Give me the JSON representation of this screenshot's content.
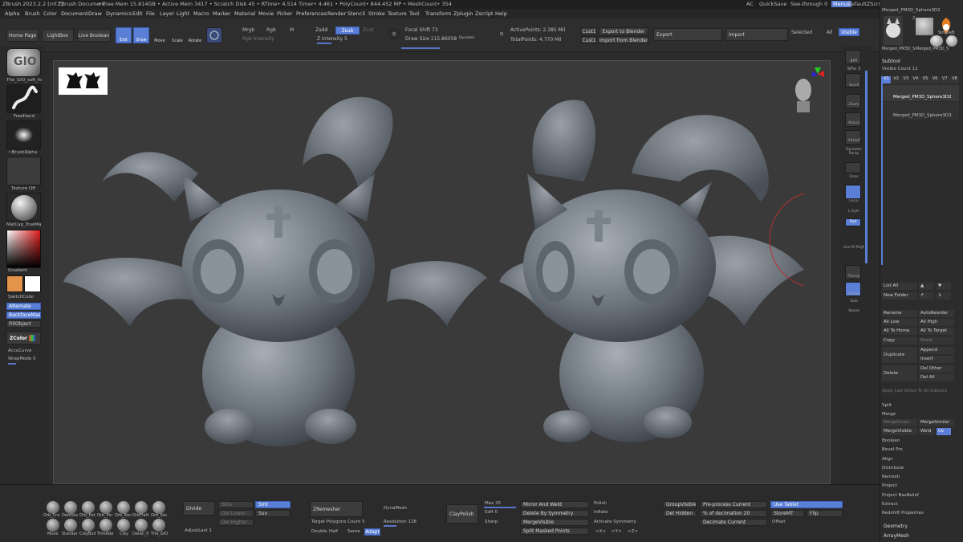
{
  "title_items": [
    "ZBrush 2023.2.2 [mf.z]",
    "ZBrush Document",
    "• Free Mem 15.814GB • Active Mem 3417 • Scratch Disk 45 • RTime• 4.514 Timer• 4.461 • PolyCount• 844.452 MP • MeshCount• 354",
    "AC",
    "QuickSave",
    "See-through  0",
    "Menus",
    "DefaultZScript"
  ],
  "menu": [
    "Alpha",
    "Brush",
    "Color",
    "Document",
    "Draw",
    "Dynamics",
    "Edit",
    "File",
    "Layer",
    "Light",
    "Macro",
    "Marker",
    "Material",
    "Movie",
    "Picker",
    "Preferences",
    "Render",
    "Stencil",
    "Stroke",
    "Texture",
    "Tool",
    "Transform",
    "Zplugin",
    "Zscript",
    "Help"
  ],
  "toolbar": {
    "home": "Home Page",
    "lightbox": "LightBox",
    "livebool": "Live Boolean",
    "edit": "Edit",
    "draw": "Draw",
    "move": "Move",
    "scale": "Scale",
    "rotate": "Rotate",
    "mrgb": "Mrgb",
    "rgb": "Rgb",
    "m": "M",
    "rgb_int": "Rgb Intensity",
    "zadd": "Zadd",
    "zsub": "Zsub",
    "zcut": "Zcut",
    "z_int": "Z Intensity 5",
    "focal": "Focal Shift 73",
    "draw_size": "Draw Size 115.86058",
    "dynamic": "Dynamic",
    "active_pts": "ActivePoints: 2.385 Mil",
    "total_pts": "TotalPoints: 4.770 Mil",
    "cust1a": "Cust1",
    "cust1b": "Cust1",
    "export_blender": "Export to Blender",
    "import_blender": "Import from Blender",
    "export": "Export",
    "import": "Import",
    "selected": "Selected",
    "all": "All",
    "visible": "Visible"
  },
  "left": {
    "brush1": "The_GIO_soft_fo",
    "brush2": "FreeHand",
    "alpha": "~BrushAlpha",
    "texture": "Texture Off",
    "material": "MatCap_TrueMa",
    "gradient": "Gradient",
    "switch": "SwitchColor",
    "alternate": "Alternate",
    "backface": "BackfaceMask",
    "fillobject": "FillObject",
    "zcolor": "ZColor",
    "accucurve": "AccuCurve",
    "wrapmode": "WrapMode 0"
  },
  "right_shelf": [
    "BPR",
    "SPix 3",
    "Scroll",
    "Zoom",
    "Actual",
    "AAHalf",
    "Dynamic Persp",
    "Floor",
    "Local",
    "L.Sym",
    "Xyz",
    "Line Fill PolyF",
    "Transp",
    "Ghost",
    "Solo",
    "Xpose"
  ],
  "tray": {
    "header": "Merged_PM3D_Sphere3D2",
    "thumb_count": "2",
    "thumb1": "Merged_PM3D_S",
    "thumb2": "Merged_PM3D_S",
    "thumb3": "Cylinder",
    "thumb4": "SimpleB",
    "subtool": "Subtool",
    "visible_count": "Visible Count 11",
    "vtabs": [
      "V1",
      "V2",
      "V3",
      "V4",
      "V5",
      "V6",
      "V7",
      "V8"
    ],
    "st1": "Merged_PM3D_Sphere3D2",
    "st2": "Merged_PM3D_Sphere3D3",
    "list_all": "List All",
    "new_folder": "New Folder",
    "rename": "Rename",
    "autoreorder": "AutoReorder",
    "all_low": "All Low",
    "all_high": "All High",
    "all_home": "All To Home",
    "all_target": "All To Target",
    "copy": "Copy",
    "paste": "Paste",
    "duplicate": "Duplicate",
    "append": "Append",
    "insert": "Insert",
    "delete": "Delete",
    "del_other": "Del Other",
    "del_all": "Del All",
    "apply": "Apply Last Action To All Subtools",
    "split": "Split",
    "merge": "Merge",
    "merge_down": "MergeDown",
    "merge_similar": "MergeSimilar",
    "merge_visible": "MergeVisible",
    "weld": "Weld",
    "uv": "Uv",
    "sections": [
      "Boolean",
      "Bevel Pro",
      "Align",
      "Distribute",
      "Remesh",
      "Project",
      "Project BasRelief",
      "Extract",
      "Redshift Properties"
    ],
    "geometry": "Geometry",
    "arraymesh": "ArrayMesh"
  },
  "bottom": {
    "brush_names": [
      "Orb_Cra",
      "DamSta",
      "Orb_Ext",
      "Orb_Pin",
      "Orb_Roc",
      "OrbFlatt",
      "Orb_Sto",
      "Move",
      "Standar",
      "ClayBuil",
      "TrimAda",
      "Clay",
      "Detail_0",
      "The_GIO"
    ],
    "divide": "Divide",
    "sdiv": "SDiv",
    "smt": "Smt",
    "suv": "Suv",
    "del_lower": "Del Lower",
    "del_higher": "Del Higher",
    "adjustlast": "AdjustLast 1",
    "zremesher": "ZRemesher",
    "target_poly": "Target Polygons Count 5",
    "double": "Double",
    "half": "Half",
    "same": "Same",
    "adapt": "Adapt",
    "dynamesh": "DynaMesh",
    "resolution": "Resolution 128",
    "claypolish": "ClayPolish",
    "max": "Max 25",
    "soft": "Soft 0",
    "sharp": "Sharp",
    "mirror_weld": "Mirror And Weld",
    "del_symmetry": "Delete By Symmetry",
    "merge_visible": "MergeVisible",
    "split_masked": "Split Masked Points",
    "polish": "Polish",
    "inflate": "Inflate",
    "activate_sym": "Activate Symmetry",
    "sym_x": ">X<",
    "sym_y": ">Y<",
    "sym_z": ">Z<",
    "groupvisible": "GroupVisible",
    "del_hidden": "Del Hidden",
    "preprocess": "Pre-process Current",
    "pct_decimation": "% of decimation 20",
    "decimate_current": "Decimate Current",
    "use_tablet": "Use Tablet",
    "storemt": "StoreMT",
    "flip": "Flip",
    "offset": "Offset"
  }
}
